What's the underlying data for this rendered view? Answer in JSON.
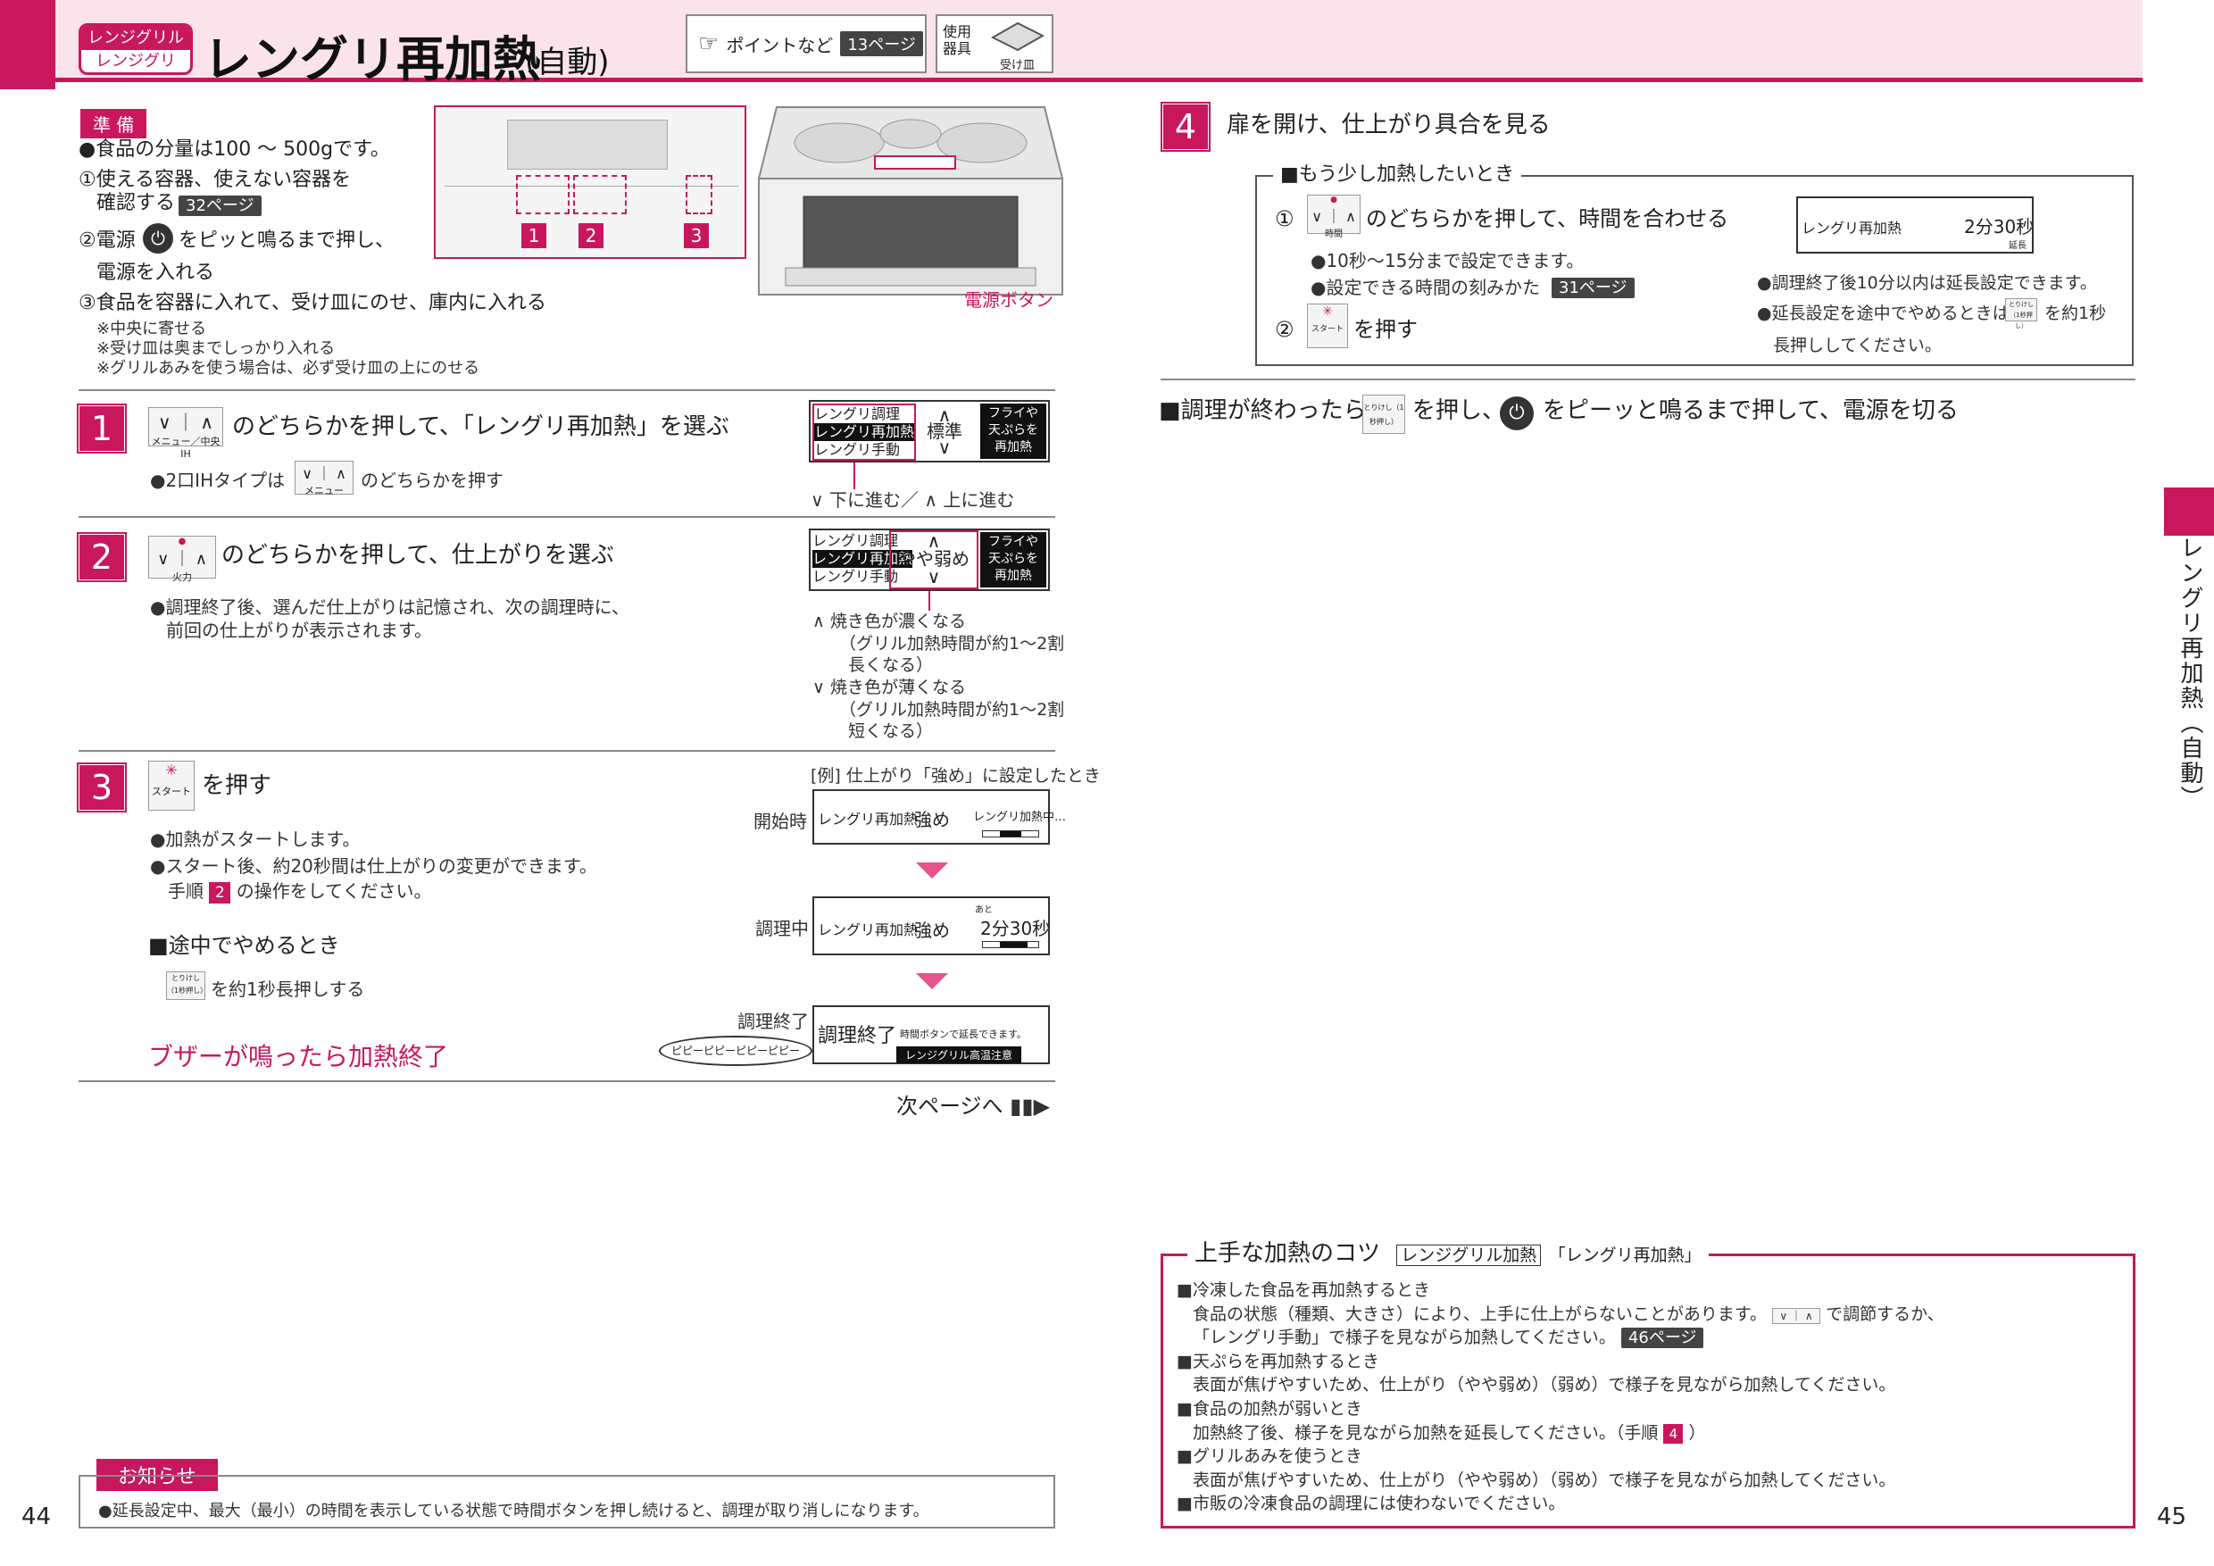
{
  "header": {
    "mode_tag_top": "レンジグリル",
    "mode_tag_bottom": "レンジグリ",
    "title": "レングリ再加熱",
    "title_sub": "(自動)",
    "ref_label": "ポイントなど",
    "ref_page": "13ページ",
    "tool_label_1": "使用",
    "tool_label_2": "器具",
    "tool_name": "受け皿"
  },
  "prep": {
    "tag": "準 備",
    "line1": "●食品の分量は100 ～ 500gです。",
    "line2a": "①使える容器、使えない容器を",
    "line2b": "確認する",
    "line2_page": "32ページ",
    "line3a": "②電源",
    "line3b": "をピッと鳴るまで押し、",
    "line3c": "電源を入れる",
    "line4": "③食品を容器に入れて、受け皿にのせ、庫内に入れる",
    "note1": "※中央に寄せる",
    "note2": "※受け皿は奥までしっかり入れる",
    "note3": "※グリルあみを使う場合は、必ず受け皿の上にのせる",
    "power_label": "電源ボタン",
    "panel_labels": [
      "1",
      "2",
      "3"
    ]
  },
  "step1": {
    "num": "1",
    "text": "のどちらかを押して、「レングリ再加熱」を選ぶ",
    "btn_label": "メニュー／中央IH",
    "note_a": "●2口IHタイプは",
    "note_b": "のどちらかを押す",
    "note_btn": "メニュー",
    "disp_lines": [
      "レングリ調理",
      "レングリ再加熱",
      "レングリ手動"
    ],
    "disp_center": "標準",
    "disp_right": [
      "フライや",
      "天ぷらを",
      "再加熱"
    ],
    "nav": "下に進む／",
    "nav2": "上に進む"
  },
  "step2": {
    "num": "2",
    "text": "のどちらかを押して、仕上がりを選ぶ",
    "btn_label": "火力",
    "note1": "●調理終了後、選んだ仕上がりは記憶され、次の調理時に、",
    "note2": "前回の仕上がりが表示されます。",
    "disp_lines": [
      "レングリ調理",
      "レングリ再加熱",
      "レングリ手動"
    ],
    "disp_center": "やや弱め",
    "disp_right": [
      "フライや",
      "天ぷらを",
      "再加熱"
    ],
    "up_1": "焼き色が濃くなる",
    "up_2": "（グリル加熱時間が約1～2割",
    "up_3": "長くなる）",
    "down_1": "焼き色が薄くなる",
    "down_2": "（グリル加熱時間が約1～2割",
    "down_3": "短くなる）"
  },
  "step3": {
    "num": "3",
    "text": "を押す",
    "btn_label": "スタート",
    "note1": "●加熱がスタートします。",
    "note2": "●スタート後、約20秒間は仕上がりの変更ができます。",
    "note3a": "手順",
    "note3_num": "2",
    "note3b": "の操作をしてください。",
    "stop_title": "■途中でやめるとき",
    "stop_btn": "とりけし（1秒押し）",
    "stop_text": "を約1秒長押しする",
    "buzzer": "ブザーが鳴ったら加熱終了",
    "example": "[例] 仕上がり「強め」に設定したとき",
    "row1_label": "開始時",
    "row1_a": "レングリ再加熱",
    "row1_b": "強め",
    "row1_c": "レングリ加熱中…",
    "row2_label": "調理中",
    "row2_a": "レングリ再加熱",
    "row2_b": "強め",
    "row2_ato": "あと",
    "row2_c": "2分30秒",
    "row3_label": "調理終了",
    "row3_a": "調理終了",
    "row3_b": "時間ボタンで延長できます。",
    "row3_c": "レンジグリル高温注意",
    "beep": "ピピーピピーピピーピピー",
    "next": "次ページへ"
  },
  "step4": {
    "num": "4",
    "text": "扉を開け、仕上がり具合を見る",
    "more_title": "■もう少し加熱したいとき",
    "more_1a": "①",
    "more_1b": "のどちらかを押して、時間を合わせる",
    "more_btn": "時間",
    "more_note1": "●10秒～15分まで設定できます。",
    "more_note2": "●設定できる時間の刻みかた",
    "more_page": "31ページ",
    "more_2a": "②",
    "more_2b": "を押す",
    "disp_a": "レングリ再加熱",
    "disp_b": "2分30秒",
    "disp_c": "延長",
    "side_note1": "●調理終了後10分以内は延長設定できます。",
    "side_note2a": "●延長設定を途中でやめるときは",
    "side_note2b": "を約1秒",
    "side_note3": "長押ししてください。"
  },
  "finish": {
    "a": "■調理が終わったら",
    "b": "を押し、",
    "c": "をピーッと鳴るまで押して、電源を切る"
  },
  "tips": {
    "title": "上手な加熱のコツ",
    "tag": "レンジグリル加熱",
    "tag2": "「レングリ再加熱」",
    "h1": "■冷凍した食品を再加熱するとき",
    "t1a": "食品の状態（種類、大きさ）により、上手に仕上がらないことがあります。",
    "t1b": "で調節するか、",
    "t1c": "「レングリ手動」で様子を見ながら加熱してください。",
    "t1_page": "46ページ",
    "h2": "■天ぷらを再加熱するとき",
    "t2": "表面が焦げやすいため、仕上がり（やや弱め）（弱め）で様子を見ながら加熱してください。",
    "h3": "■食品の加熱が弱いとき",
    "t3a": "加熱終了後、様子を見ながら加熱を延長してください。（手順",
    "t3_num": "4",
    "t3b": "）",
    "h4": "■グリルあみを使うとき",
    "t4": "表面が焦げやすいため、仕上がり（やや弱め）（弱め）で様子を見ながら加熱してください。",
    "h5": "■市販の冷凍食品の調理には使わないでください。"
  },
  "notice": {
    "tag": "お知らせ",
    "text": "●延長設定中、最大（最小）の時間を表示している状態で時間ボタンを押し続けると、調理が取り消しになります。"
  },
  "side_tab": "レングリ再加熱（自動）",
  "page_left": "44",
  "page_right": "45",
  "colors": {
    "accent": "#c8175d",
    "header_bg": "#fbe3ec"
  }
}
